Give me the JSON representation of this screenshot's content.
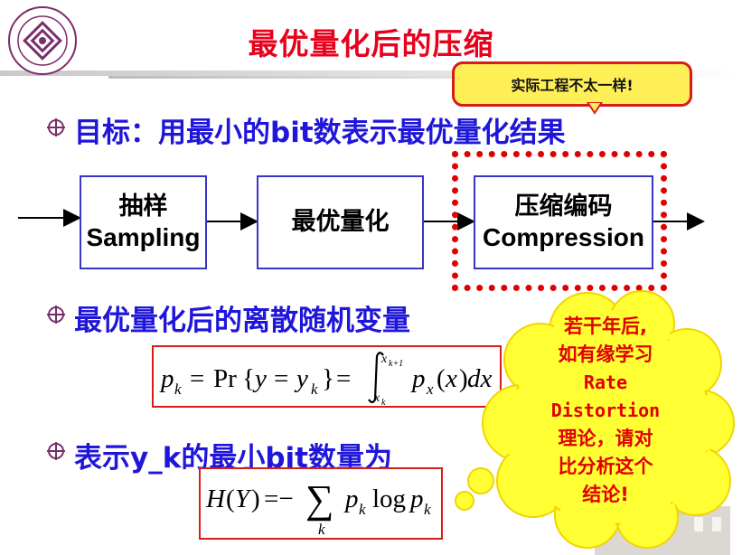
{
  "slide": {
    "title": "最优量化后的压缩",
    "note": "实际工程不太一样!",
    "bullets": [
      "目标：用最小的bit数表示最优量化结果",
      "最优量化后的离散随机变量",
      "表示y_k的最小bit数量为"
    ],
    "blocks": {
      "sampling_cn": "抽样",
      "sampling_en": "Sampling",
      "quantize": "最优量化",
      "compress_cn": "压缩编码",
      "compress_en": "Compression"
    },
    "cloud_lines": [
      "若干年后,",
      "如有缘学习",
      "Rate",
      "Distortion",
      "理论，请对",
      "比分析这个",
      "结论!"
    ],
    "formula1": {
      "p": "p",
      "k": "k",
      "eq": "=",
      "pr": "Pr",
      "y": "y",
      "yk": "y",
      "x": "x",
      "upper": "x",
      "upper_sub": "k+1",
      "lower": "x",
      "lower_sub": "k",
      "dx": "dx"
    },
    "formula2": {
      "H": "H",
      "Y": "Y",
      "sum_sub": "k",
      "log": "log"
    }
  },
  "colors": {
    "title": "#e8001c",
    "bullet_text": "#1f16d9",
    "note_bg": "#ffef57",
    "cloud_bg": "#ffff33",
    "cloud_text": "#e00000",
    "dash_border": "#e00000"
  },
  "icons": {
    "logo": "university-seal-icon",
    "bullet": "circle-cross-bullet-icon"
  }
}
